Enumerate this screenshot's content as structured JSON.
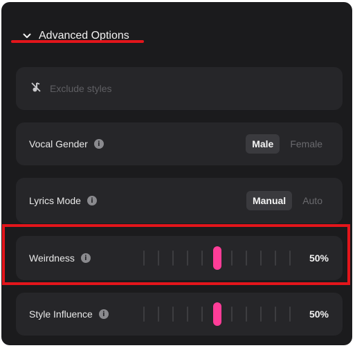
{
  "advanced": {
    "title": "Advanced Options",
    "exclude_placeholder": "Exclude styles",
    "vocal_gender": {
      "label": "Vocal Gender",
      "options": [
        "Male",
        "Female"
      ],
      "selected": "Male"
    },
    "lyrics_mode": {
      "label": "Lyrics Mode",
      "options": [
        "Manual",
        "Auto"
      ],
      "selected": "Manual"
    },
    "weirdness": {
      "label": "Weirdness",
      "value": 0.5,
      "display": "50%"
    },
    "style_influence": {
      "label": "Style Influence",
      "value": 0.5,
      "display": "50%"
    }
  },
  "colors": {
    "accent": "#ff3d98",
    "annotation": "#e3151b"
  },
  "icons": {
    "chevron": "chevron-down-icon",
    "exclude": "music-off-icon",
    "info": "info-icon"
  }
}
